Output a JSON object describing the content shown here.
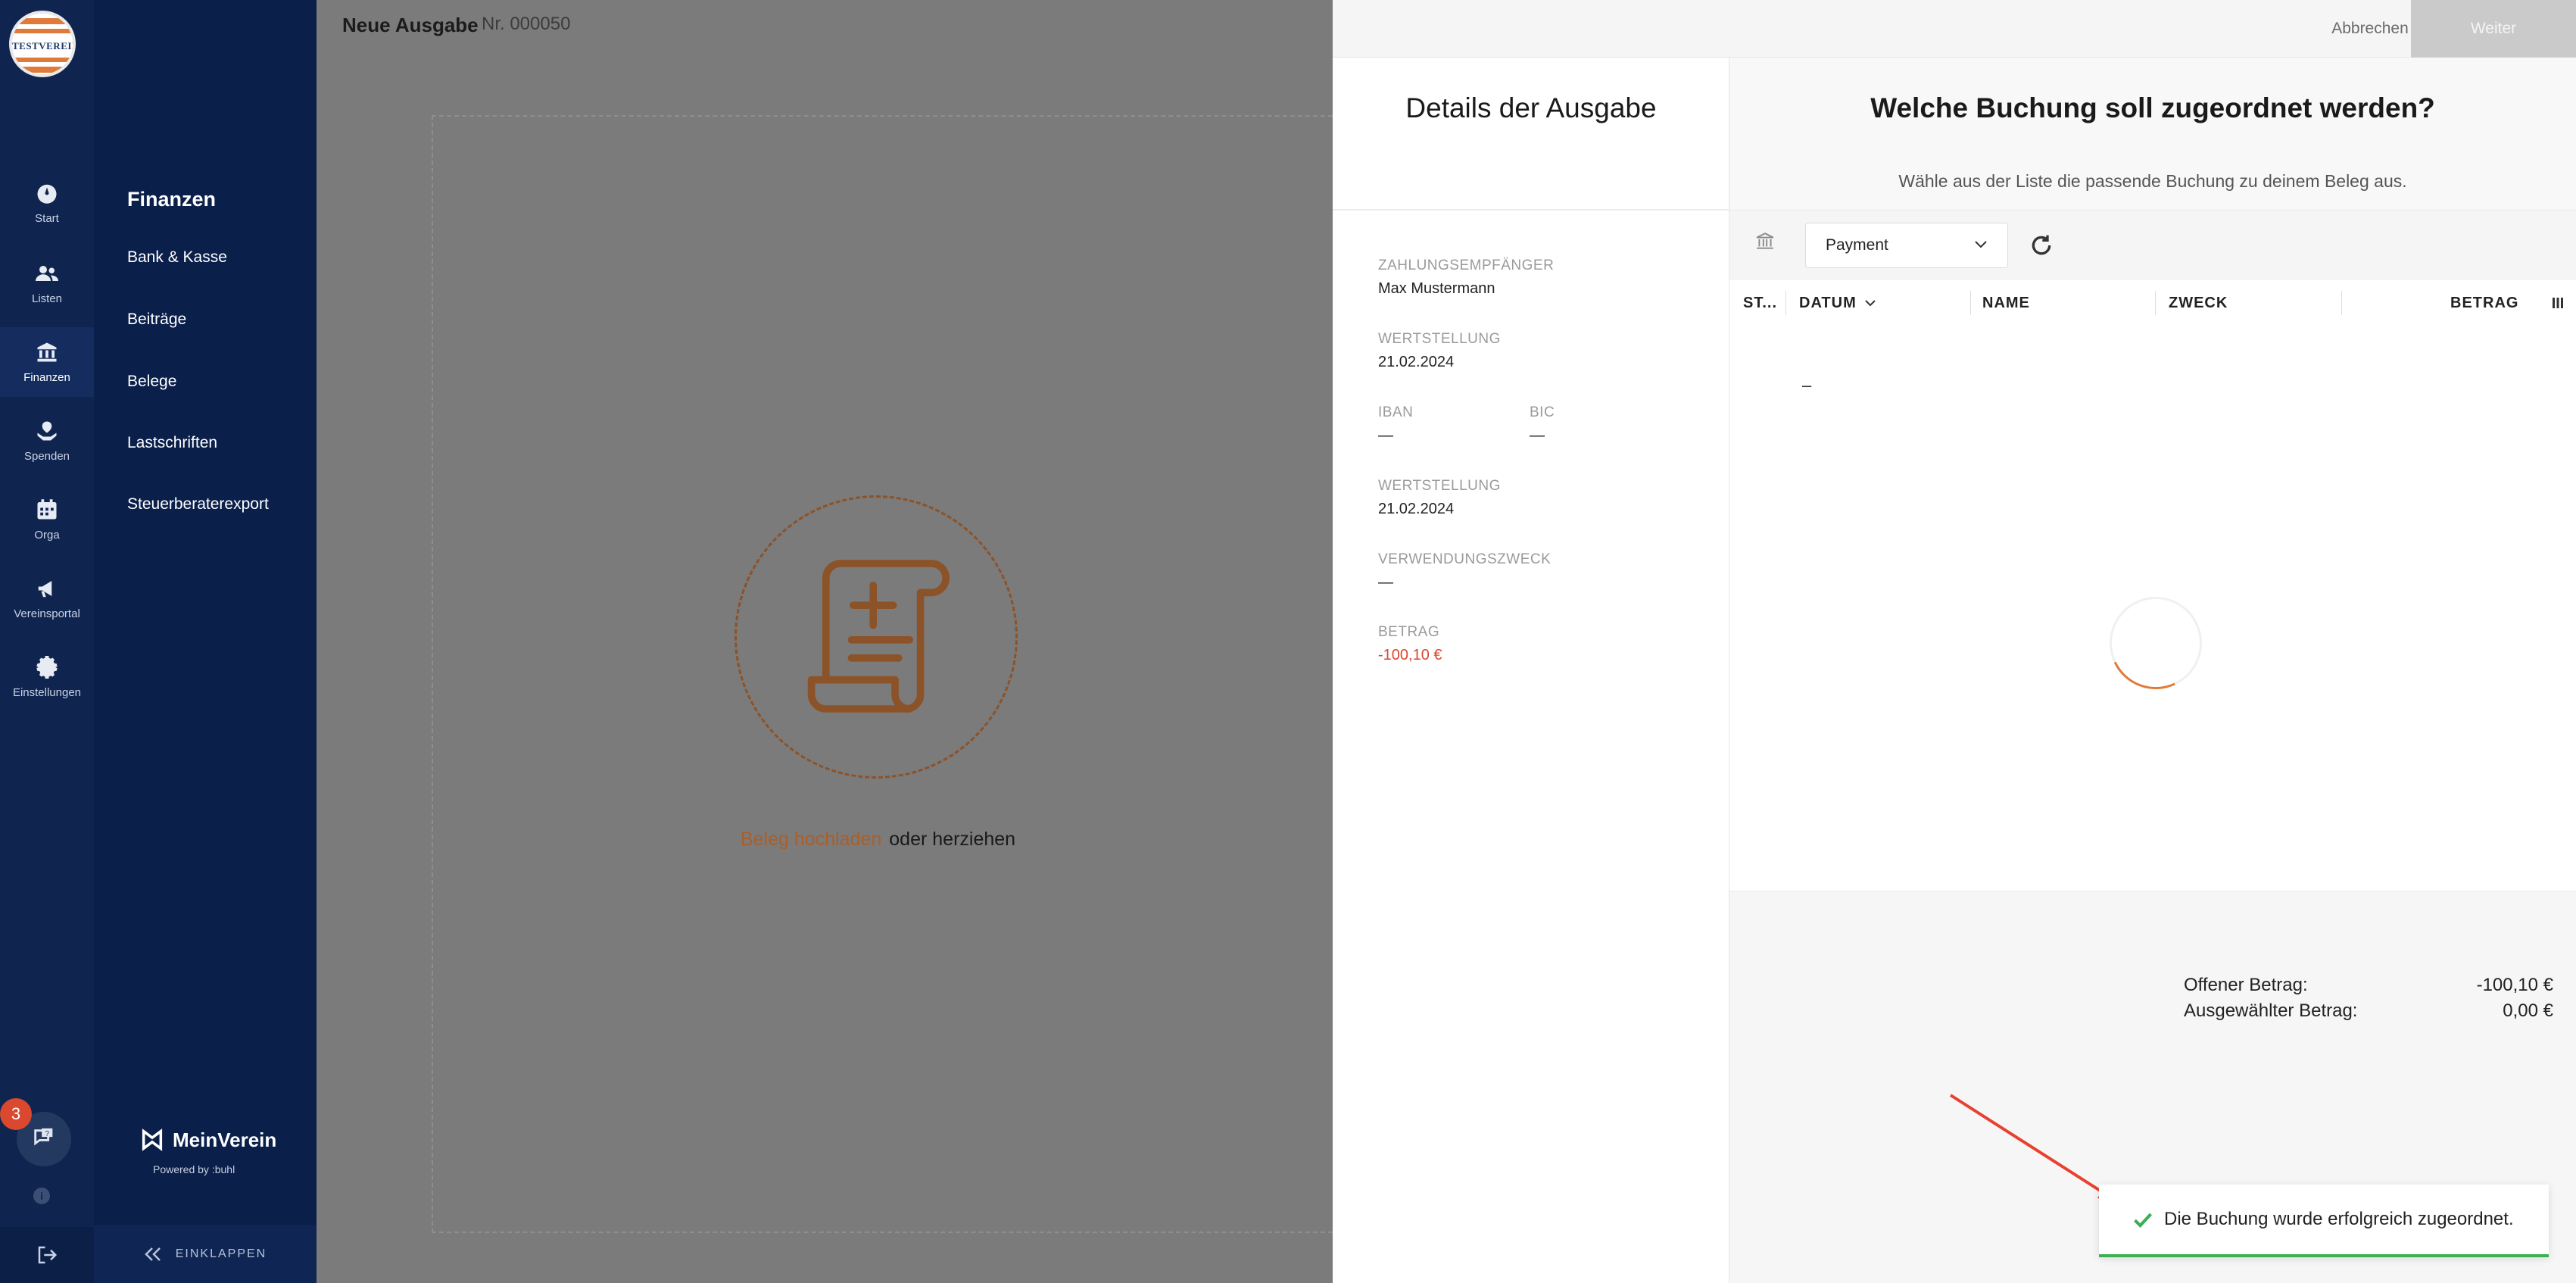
{
  "org": {
    "logo_text": "TESTVEREIN"
  },
  "rail": {
    "items": [
      {
        "label": "Start",
        "icon": "dashboard-icon"
      },
      {
        "label": "Listen",
        "icon": "people-icon"
      },
      {
        "label": "Finanzen",
        "icon": "bank-icon"
      },
      {
        "label": "Spenden",
        "icon": "donation-icon"
      },
      {
        "label": "Orga",
        "icon": "calendar-icon"
      },
      {
        "label": "Vereinsportal",
        "icon": "megaphone-icon"
      },
      {
        "label": "Einstellungen",
        "icon": "gear-icon"
      }
    ],
    "active": "Finanzen",
    "chat_badge": "3"
  },
  "subnav": {
    "title": "Finanzen",
    "links": [
      "Bank & Kasse",
      "Beiträge",
      "Belege",
      "Lastschriften",
      "Steuerberaterexport"
    ],
    "brand_name": "MeinVerein",
    "powered_by": "Powered by :buhl",
    "collapse_label": "EINKLAPPEN"
  },
  "main": {
    "title": "Neue Ausgabe",
    "number": "Nr. 000050",
    "upload_link": "Beleg hochladen",
    "upload_rest": "oder herziehen"
  },
  "panel": {
    "cancel_label": "Abbrechen",
    "next_label": "Weiter",
    "details": {
      "title": "Details der Ausgabe",
      "recipient_label": "ZAHLUNGSEMPFÄNGER",
      "recipient_value": "Max Mustermann",
      "valuta1_label": "WERTSTELLUNG",
      "valuta1_value": "21.02.2024",
      "iban_label": "IBAN",
      "iban_value": "—",
      "bic_label": "BIC",
      "bic_value": "—",
      "valuta2_label": "WERTSTELLUNG",
      "valuta2_value": "21.02.2024",
      "purpose_label": "VERWENDUNGSZWECK",
      "purpose_value": "—",
      "amount_label": "BETRAG",
      "amount_value": "-100,10 €"
    },
    "assign": {
      "title": "Welche Buchung soll zugeordnet werden?",
      "hint": "Wähle aus der Liste die passende Buchung zu deinem Beleg aus.",
      "account_select": "Payment",
      "columns": [
        "ST...",
        "DATUM",
        "NAME",
        "ZWECK",
        "BETRAG"
      ],
      "empty_dash": "–",
      "open_amount_label": "Offener Betrag:",
      "open_amount_value": "-100,10 €",
      "selected_amount_label": "Ausgewählter Betrag:",
      "selected_amount_value": "0,00 €"
    }
  },
  "toast": {
    "message": "Die Buchung wurde erfolgreich zugeordnet."
  },
  "colors": {
    "accent": "#e07a3a",
    "success": "#3bb052",
    "negative": "#d9482f",
    "nav": "#0f2550"
  }
}
